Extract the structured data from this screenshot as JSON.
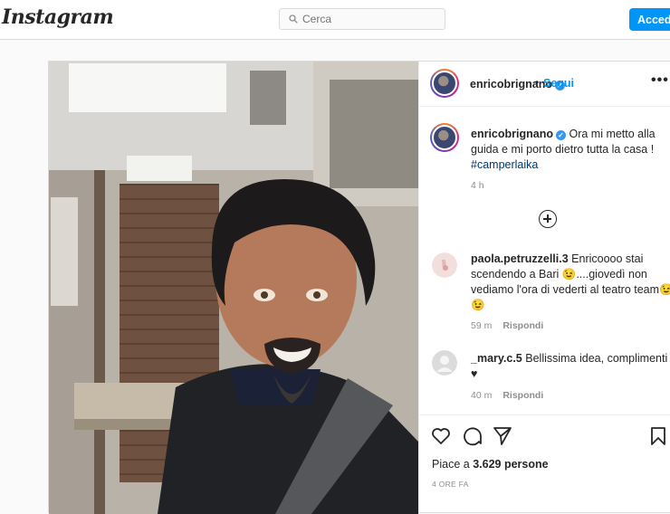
{
  "header": {
    "logo": "Instagram",
    "search_placeholder": "Cerca",
    "login_label": "Accedi"
  },
  "post": {
    "author": "enricobrignano",
    "follow_label": "Segui",
    "more_label": "•••",
    "caption_author": "enricobrignano",
    "caption_text": "Ora mi metto alla guida e mi porto dietro tutta la casa !",
    "caption_tag": "#camperlaika",
    "caption_time": "4 h",
    "comments": [
      {
        "user": "paola.petruzzelli.3",
        "text": "Enricoooo stai scendendo a Bari 😉....giovedì non vediamo l'ora di vederti al teatro team😉 😉",
        "time": "59 m",
        "reply": "Rispondi"
      },
      {
        "user": "_mary.c.5",
        "text": "Bellissima idea, complimenti ♥",
        "time": "40 m",
        "reply": "Rispondi"
      }
    ],
    "likes_prefix": "Piace a",
    "likes_count": "3.629",
    "likes_suffix": "persone",
    "posted_ago": "4 ORE FA"
  },
  "icons": [
    "search-icon",
    "verified-icon",
    "more-options-icon",
    "load-more-icon",
    "heart-icon",
    "comment-icon",
    "share-icon",
    "save-icon"
  ],
  "colors": {
    "accent": "#0095f6",
    "verified": "#3897f0",
    "border": "#dbdbdb"
  }
}
